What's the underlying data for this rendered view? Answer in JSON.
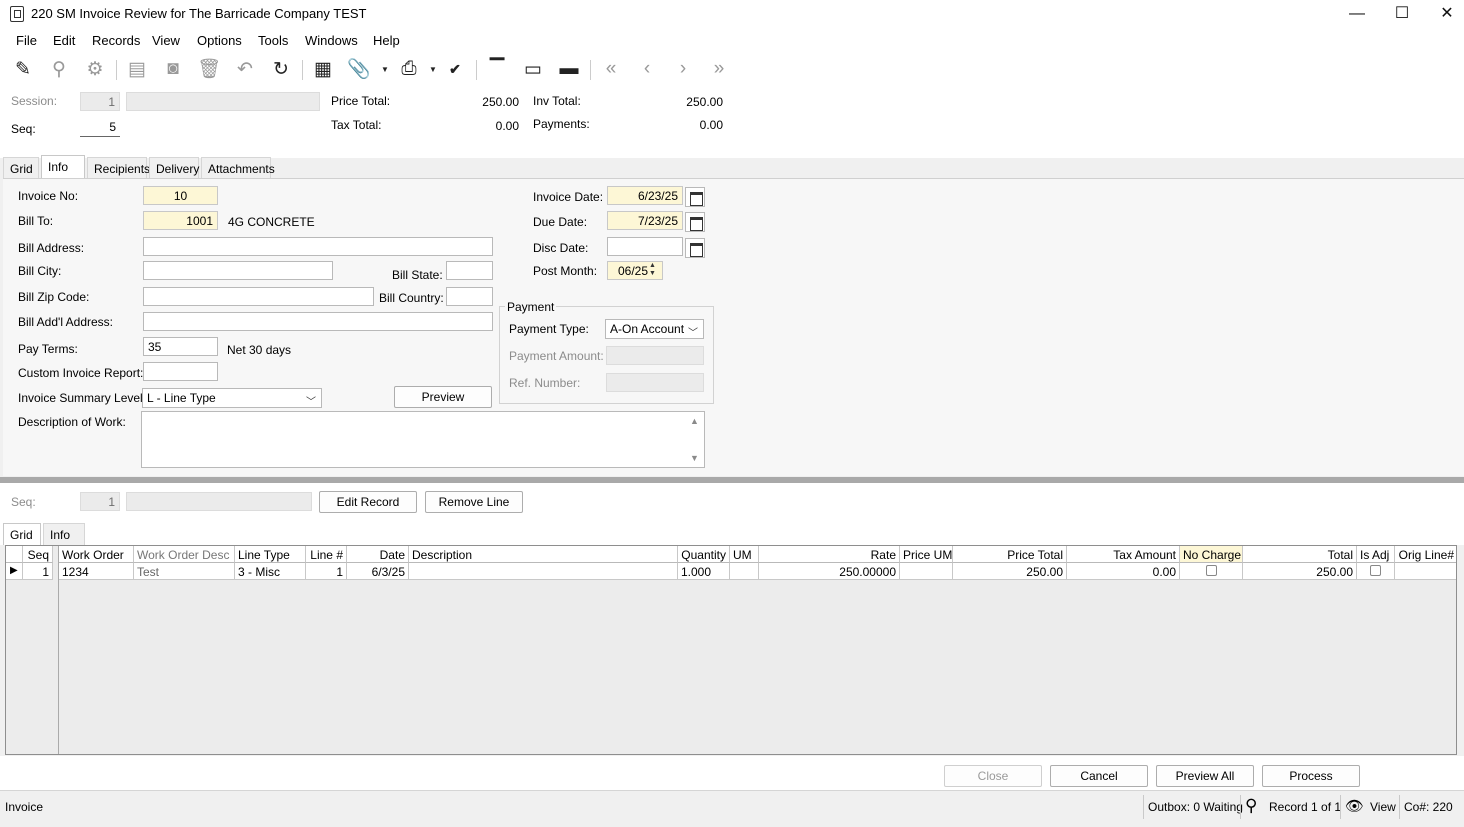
{
  "window": {
    "title": "220 SM Invoice Review for The Barricade Company TEST",
    "minimize": "—",
    "maximize": "☐",
    "close": "✕"
  },
  "menu": [
    "File",
    "Edit",
    "Records",
    "View",
    "Options",
    "Tools",
    "Windows",
    "Help"
  ],
  "toolbar_icons": [
    "edit-icon",
    "binoculars-icon",
    "gear-icon",
    "new-document-icon",
    "save-icon",
    "delete-icon",
    "undo-icon",
    "refresh-icon",
    "grid-icon",
    "attachment-icon",
    "print-icon",
    "spellcheck-icon",
    "layout-top-icon",
    "layout-middle-icon",
    "layout-bottom-icon",
    "first-record-icon",
    "previous-record-icon",
    "next-record-icon",
    "last-record-icon"
  ],
  "header": {
    "session_label": "Session:",
    "session_value": "1",
    "seq_label": "Seq:",
    "seq_value": "5",
    "price_total_label": "Price Total:",
    "price_total_value": "250.00",
    "tax_total_label": "Tax Total:",
    "tax_total_value": "0.00",
    "inv_total_label": "Inv Total:",
    "inv_total_value": "250.00",
    "payments_label": "Payments:",
    "payments_value": "0.00"
  },
  "top_tabs": [
    "Grid",
    "Info",
    "Recipients",
    "Delivery",
    "Attachments"
  ],
  "info": {
    "invoice_no_label": "Invoice No:",
    "invoice_no": "10",
    "bill_to_label": "Bill To:",
    "bill_to": "1001",
    "bill_to_name": "4G CONCRETE",
    "bill_address_label": "Bill Address:",
    "bill_address": "",
    "bill_city_label": "Bill City:",
    "bill_city": "",
    "bill_state_label": "Bill State:",
    "bill_state": "",
    "bill_zip_label": "Bill Zip Code:",
    "bill_zip": "",
    "bill_country_label": "Bill Country:",
    "bill_country": "",
    "bill_addl_label": "Bill Add'l Address:",
    "bill_addl": "",
    "pay_terms_label": "Pay Terms:",
    "pay_terms": "35",
    "pay_terms_desc": "Net 30 days",
    "custom_report_label": "Custom Invoice Report:",
    "custom_report": "",
    "summary_level_label": "Invoice Summary Level:",
    "summary_level": "L - Line Type",
    "preview_button": "Preview",
    "description_label": "Description of Work:",
    "description": "",
    "invoice_date_label": "Invoice Date:",
    "invoice_date": "6/23/25",
    "due_date_label": "Due Date:",
    "due_date": "7/23/25",
    "disc_date_label": "Disc Date:",
    "disc_date": "",
    "post_month_label": "Post Month:",
    "post_month": "06/25",
    "payment_group_label": "Payment",
    "payment_type_label": "Payment Type:",
    "payment_type": "A-On Account",
    "payment_amount_label": "Payment Amount:",
    "payment_amount": "",
    "ref_number_label": "Ref. Number:",
    "ref_number": ""
  },
  "lines": {
    "seq_label": "Seq:",
    "seq_value": "1",
    "edit_record_button": "Edit Record",
    "remove_line_button": "Remove Line",
    "tabs": [
      "Grid",
      "Info"
    ],
    "columns": [
      "Seq",
      "Work Order",
      "Work Order Desc",
      "Line Type",
      "Line #",
      "Date",
      "Description",
      "Quantity",
      "UM",
      "Rate",
      "Price UM",
      "Price Total",
      "Tax Amount",
      "No Charge",
      "Total",
      "Is Adj",
      "Orig Line#"
    ],
    "rows": [
      {
        "seq": "1",
        "work_order": "1234",
        "work_order_desc": "Test",
        "line_type": "3 - Misc",
        "line_no": "1",
        "date": "6/3/25",
        "description": "",
        "quantity": "1.000",
        "um": "",
        "rate": "250.00000",
        "price_um": "",
        "price_total": "250.00",
        "tax_amount": "0.00",
        "total": "250.00",
        "orig_line": ""
      }
    ]
  },
  "buttons": {
    "close": "Close",
    "cancel": "Cancel",
    "preview_all": "Preview All",
    "process": "Process"
  },
  "status": {
    "left": "Invoice",
    "outbox": "Outbox: 0 Waiting",
    "record": "Record 1 of 1",
    "view": "View",
    "company": "Co#: 220"
  }
}
